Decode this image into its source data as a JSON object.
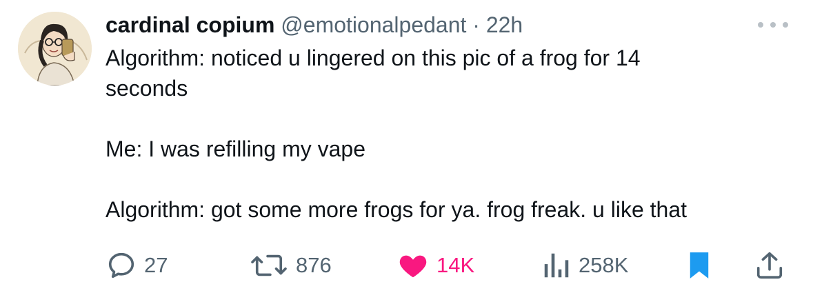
{
  "tweet": {
    "author_name": "cardinal copium",
    "handle": "@emotionalpedant",
    "separator": "·",
    "time": "22h",
    "lines": [
      "Algorithm: noticed u lingered on this pic of a frog for 14",
      "seconds",
      "",
      "Me: I was refilling my vape",
      "",
      "Algorithm: got some more frogs for ya. frog freak. u like that"
    ]
  },
  "actions": {
    "replies": "27",
    "reposts": "876",
    "likes": "14K",
    "views": "258K"
  },
  "colors": {
    "text": "#0f1419",
    "muted": "#536471",
    "like": "#f91880",
    "bookmark": "#1d9bf0"
  },
  "icons": [
    "reply-icon",
    "repost-icon",
    "heart-icon",
    "views-icon",
    "bookmark-icon",
    "share-icon",
    "more-icon"
  ]
}
